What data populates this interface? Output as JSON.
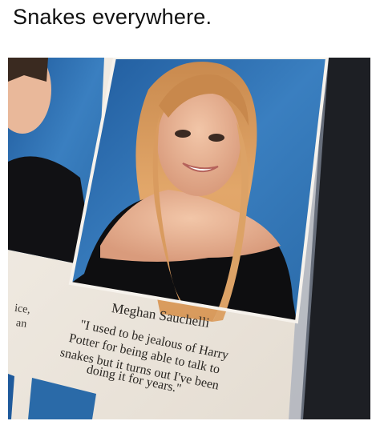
{
  "caption": "Snakes everywhere.",
  "yearbook": {
    "student_name": "Meghan Sauchelli",
    "quote_lines": [
      "\"I used to be jealous of Harry",
      "Potter for being able to talk to",
      "snakes but it turns out I've been",
      "doing it for years.\""
    ],
    "left_fragments": [
      "ice,",
      "an"
    ]
  },
  "colors": {
    "backdrop_blue": "#2f6fb0",
    "page_cream": "#efe9df",
    "hair_blonde": "#d9995a",
    "top_black": "#0e0e10"
  }
}
